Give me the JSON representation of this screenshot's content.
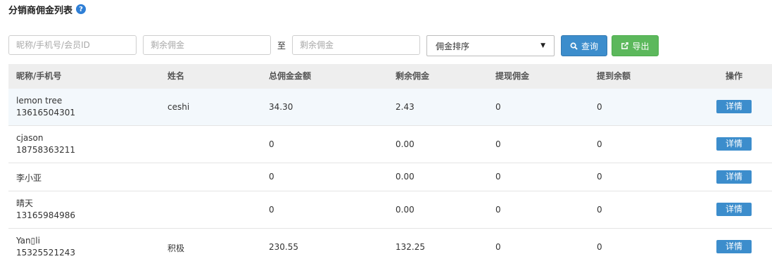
{
  "header": {
    "title": "分销商佣金列表",
    "help_icon": "?"
  },
  "filters": {
    "search_placeholder": "昵称/手机号/会员ID",
    "min_placeholder": "剩余佣金",
    "to_label": "至",
    "max_placeholder": "剩余佣金",
    "sort_select": "佣金排序",
    "query_label": "查询",
    "export_label": "导出"
  },
  "table": {
    "headers": [
      "昵称/手机号",
      "姓名",
      "总佣金金额",
      "剩余佣金",
      "提现佣金",
      "提到余额",
      "操作"
    ],
    "rows": [
      {
        "nickname": "lemon tree",
        "phone": "13616504301",
        "name": "ceshi",
        "total": "34.30",
        "remaining": "2.43",
        "withdrawn": "0",
        "to_balance": "0",
        "action": "详情"
      },
      {
        "nickname": "cjason",
        "phone": "18758363211",
        "name": "",
        "total": "0",
        "remaining": "0.00",
        "withdrawn": "0",
        "to_balance": "0",
        "action": "详情"
      },
      {
        "nickname": "李小亚",
        "phone": "",
        "name": "",
        "total": "0",
        "remaining": "0.00",
        "withdrawn": "0",
        "to_balance": "0",
        "action": "详情"
      },
      {
        "nickname": "晴天",
        "phone": "13165984986",
        "name": "",
        "total": "0",
        "remaining": "0.00",
        "withdrawn": "0",
        "to_balance": "0",
        "action": "详情"
      },
      {
        "nickname": "Yan▯li",
        "phone": "15325521243",
        "name": "积极",
        "total": "230.55",
        "remaining": "132.25",
        "withdrawn": "0",
        "to_balance": "0",
        "action": "详情"
      }
    ]
  },
  "colors": {
    "primary": "#3c8dcc",
    "success": "#5cb85c",
    "header_bg": "#eeeeee",
    "highlight_row": "#f3f8fc"
  },
  "icons": {
    "help": "question-circle-icon",
    "query": "search-icon",
    "export": "external-link-icon"
  }
}
